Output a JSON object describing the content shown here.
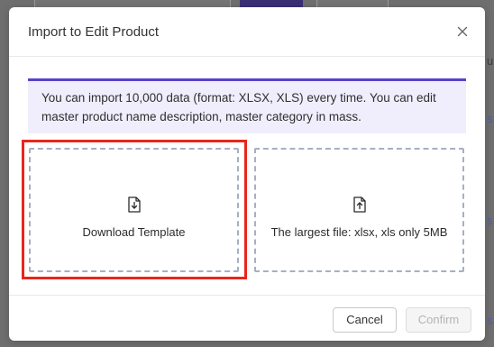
{
  "modal": {
    "title": "Import to Edit Product",
    "close_icon": "close-icon"
  },
  "info_banner": {
    "text": "You can import 10,000 data (format: XLSX, XLS) every time. You can edit master product name description, master category in mass."
  },
  "download_zone": {
    "icon": "download-file-icon",
    "label": "Download Template"
  },
  "upload_zone": {
    "icon": "upload-file-icon",
    "label": "The largest file: xlsx, xls only 5MB"
  },
  "footer": {
    "cancel_label": "Cancel",
    "confirm_label": "Confirm"
  },
  "colors": {
    "accent": "#5b42c9",
    "banner_background": "#f0eefc",
    "highlight": "#e8261c",
    "dashed_border": "#a6b0c2"
  }
}
